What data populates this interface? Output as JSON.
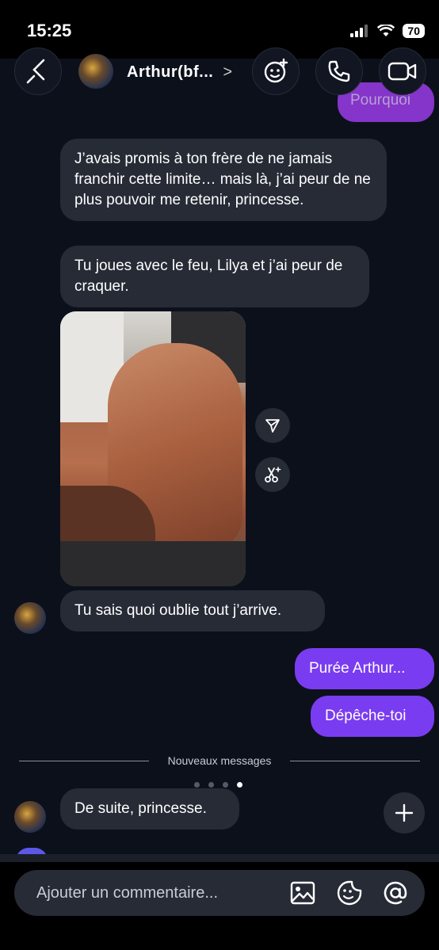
{
  "status_bar": {
    "time": "15:25",
    "battery": "70"
  },
  "header": {
    "contact_name": "Arthur(bf...",
    "chevron": ">"
  },
  "top_partial_message": "Pourquoi",
  "messages": [
    {
      "sender": "them",
      "text": "J’avais promis à ton frère  de ne jamais franchir cette limite… mais là, j’ai peur de ne plus pouvoir me retenir, princesse."
    },
    {
      "sender": "them",
      "text": "Tu joues avec le feu, Lilya et j’ai peur de craquer."
    },
    {
      "sender": "them",
      "text": "Tu sais quoi oublie tout j’arrive."
    },
    {
      "sender": "me",
      "text": "Purée Arthur..."
    },
    {
      "sender": "me",
      "text": "Dépêche-toi"
    },
    {
      "sender": "them",
      "text": "De suite, princesse."
    }
  ],
  "divider": {
    "label": "Nouveaux messages"
  },
  "composer": {
    "placeholder": "Ajouter un commentaire..."
  },
  "colors": {
    "background": "#0c101b",
    "bubble_them": "#262b36",
    "bubble_me": "#7a3cf0"
  },
  "icons": [
    "back-icon",
    "effects-icon",
    "phone-icon",
    "video-icon",
    "share-icon",
    "scissors-icon",
    "minimize-icon",
    "image-icon",
    "sticker-icon",
    "at-icon"
  ]
}
